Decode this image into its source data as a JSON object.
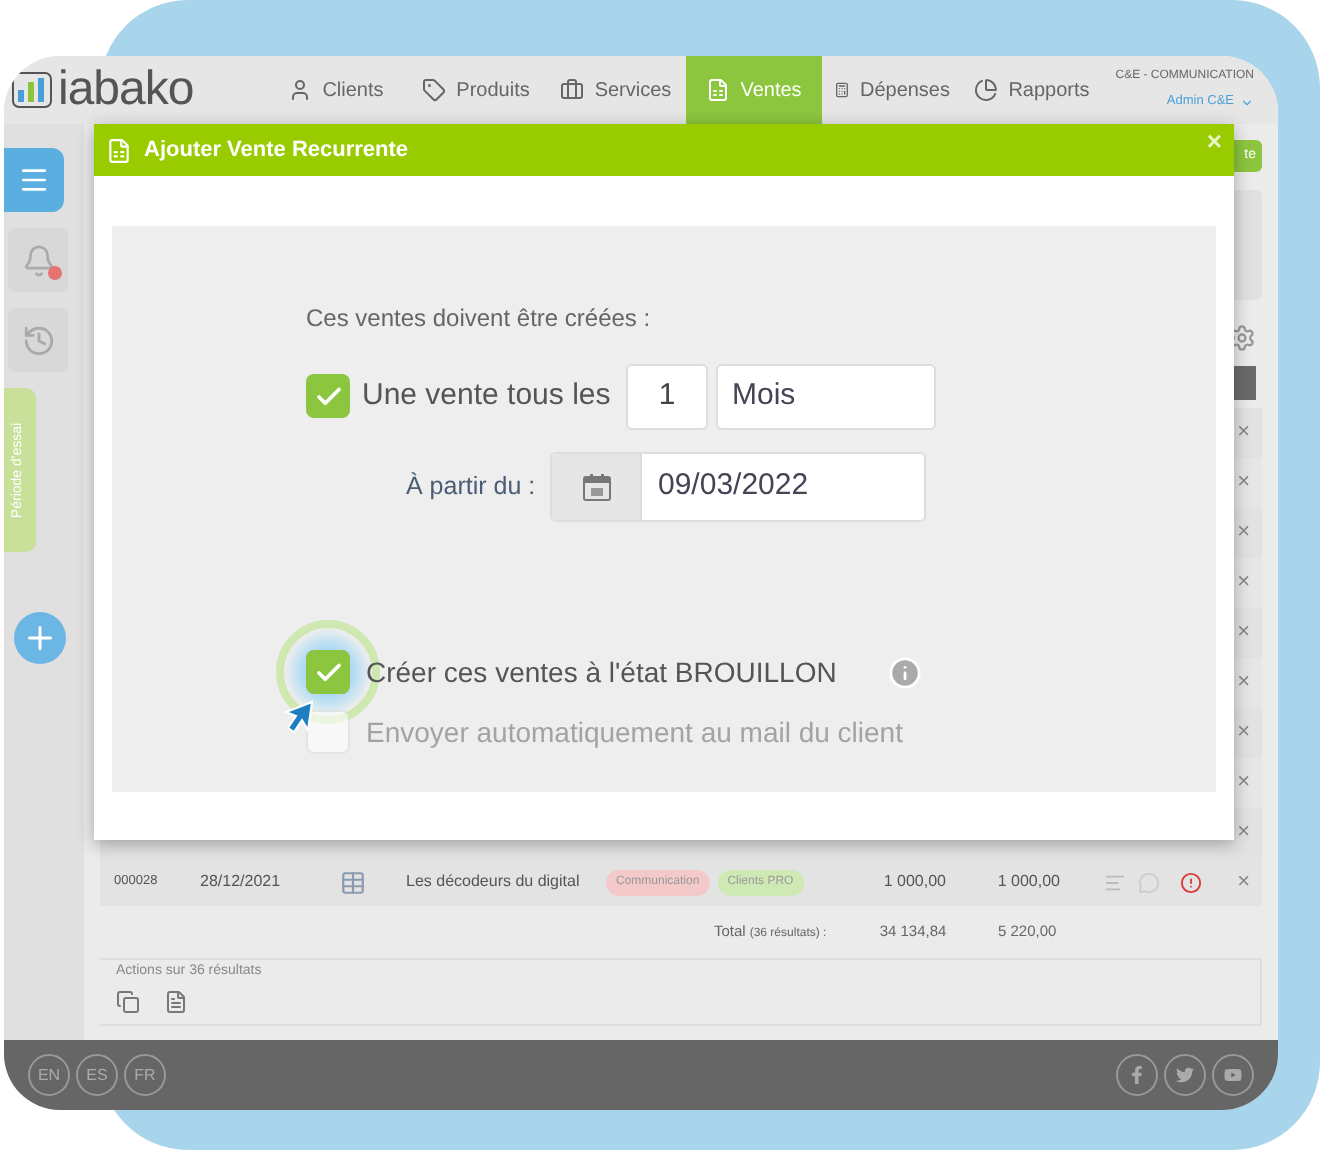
{
  "header": {
    "logo": "iabako",
    "tabs": [
      {
        "label": "Clients",
        "selected": false
      },
      {
        "label": "Produits",
        "selected": false
      },
      {
        "label": "Services",
        "selected": false
      },
      {
        "label": "Ventes",
        "selected": true
      },
      {
        "label": "Dépenses",
        "selected": false
      },
      {
        "label": "Rapports",
        "selected": false
      }
    ],
    "company": "C&E - COMMUNICATION",
    "user": "Admin C&E"
  },
  "sidebar": {
    "trial_tab": "Période d'essai"
  },
  "page": {
    "top_button": "te",
    "delete_marks": [
      "×",
      "×",
      "×",
      "×",
      "×",
      "×",
      "×",
      "×",
      "×"
    ],
    "row": {
      "number": "000028",
      "date": "28/12/2021",
      "client": "Les décodeurs du digital",
      "tags": [
        {
          "label": "Communication",
          "color": "#f3c9c9"
        },
        {
          "label": "Clients PRO",
          "color": "#cfe9b4"
        }
      ],
      "amount_1": "1 000,00",
      "amount_2": "1 000,00",
      "delete": "×"
    },
    "total": {
      "label": "Total",
      "count": "(36 résultats) :",
      "value_1": "34 134,84",
      "value_2": "5 220,00"
    },
    "actions": {
      "title": "Actions sur 36 résultats"
    }
  },
  "modal": {
    "title": "Ajouter Vente Recurrente",
    "close": "×",
    "intro": "Ces ventes doivent être créées :",
    "repeat": {
      "label": "Une vente tous les",
      "checked": true,
      "count": "1",
      "unit": "Mois"
    },
    "start": {
      "label": "À partir du :",
      "date": "09/03/2022"
    },
    "options": [
      {
        "label": "Créer ces ventes à l'état BROUILLON",
        "checked": true,
        "disabled": false,
        "info": true
      },
      {
        "label": "Envoyer automatiquement au mail du client",
        "checked": false,
        "disabled": true,
        "info": false
      }
    ]
  },
  "footer": {
    "languages": [
      "EN",
      "ES",
      "FR"
    ]
  }
}
